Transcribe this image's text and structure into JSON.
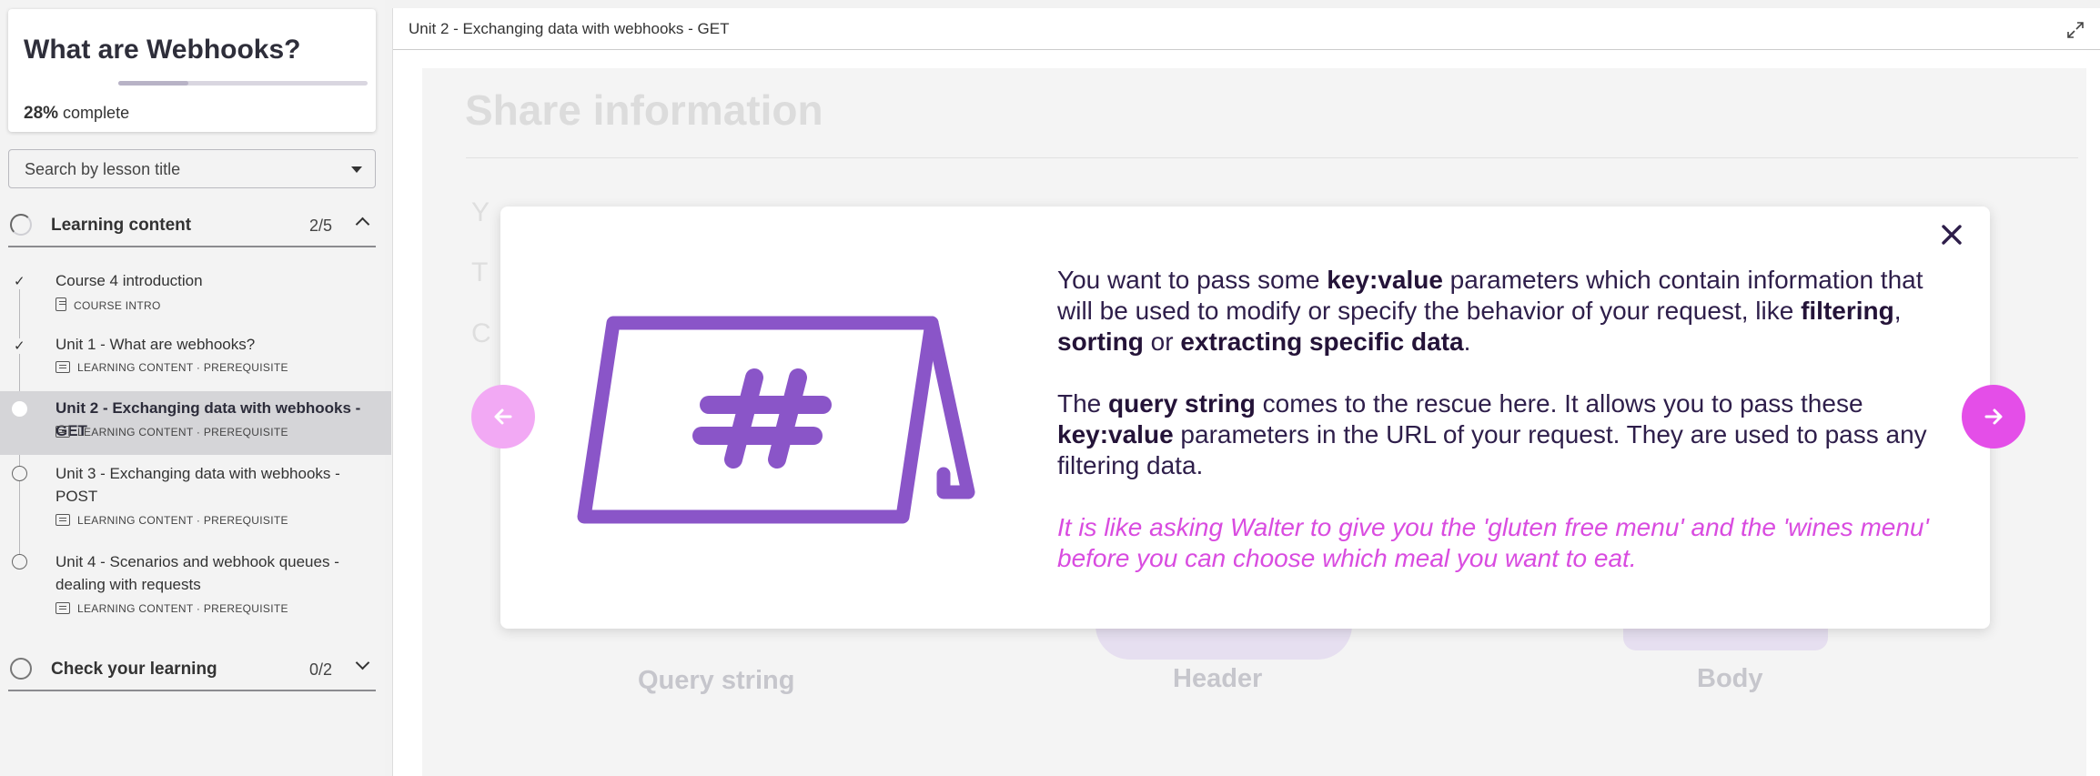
{
  "sidebar": {
    "course_title": "What are Webhooks?",
    "progress_percent": 28,
    "progress_pct_label": "28%",
    "progress_suffix": "complete",
    "search_placeholder": "Search by lesson title",
    "sections": [
      {
        "title": "Learning content",
        "count": "2/5",
        "expanded": true,
        "lessons": [
          {
            "name": "Course 4 introduction",
            "meta": "COURSE INTRO",
            "completed": true,
            "icon": "document-icon"
          },
          {
            "name": "Unit 1 - What are webhooks?",
            "meta": "LEARNING CONTENT · PREREQUISITE",
            "completed": true,
            "icon": "slides-icon"
          },
          {
            "name": "Unit 2 - Exchanging data with webhooks - GET",
            "meta": "LEARNING CONTENT · PREREQUISITE",
            "completed": false,
            "active": true,
            "icon": "slides-icon"
          },
          {
            "name": "Unit 3 - Exchanging data with webhooks - POST",
            "meta": "LEARNING CONTENT · PREREQUISITE",
            "completed": false,
            "icon": "slides-icon"
          },
          {
            "name": "Unit 4 - Scenarios and webhook queues - dealing with requests",
            "meta": "LEARNING CONTENT · PREREQUISITE",
            "completed": false,
            "icon": "slides-icon"
          }
        ]
      },
      {
        "title": "Check your learning",
        "count": "0/2",
        "expanded": false
      }
    ]
  },
  "main": {
    "lesson_title": "Unit 2 - Exchanging data with webhooks - GET",
    "slide": {
      "heading": "Share information",
      "background_labels": [
        "Query string",
        "Header",
        "Body"
      ]
    },
    "modal": {
      "paragraph1": {
        "t1": "You want to pass some ",
        "b1": "key:value",
        "t2": " parameters which contain information that will be used to modify or specify the behavior of your request, like ",
        "b2": "filtering",
        "t3": ", ",
        "b3": "sorting",
        "t4": " or ",
        "b4": "extracting specific data",
        "t5": "."
      },
      "paragraph2": {
        "t1": "The ",
        "b1": "query string",
        "t2": " comes to the rescue here. It allows you to pass these ",
        "b2": "key:value",
        "t3": " parameters in the URL of your request. They are used to pass any filtering data."
      },
      "accent_text": "It is like asking Walter to give you the 'gluten free menu' and the 'wines menu' before you can choose which meal you want to eat."
    }
  },
  "colors": {
    "accent_pink": "#e44ee8",
    "accent_pink_light": "#f2a9f4",
    "illustration_purple": "#8a55c8",
    "text_dark": "#2e1e4a"
  },
  "icons": [
    "expand-icon",
    "close-icon",
    "arrow-left-icon",
    "arrow-right-icon",
    "hashtag-sign-icon",
    "chevron-up-icon",
    "chevron-down-icon",
    "check-icon",
    "dropdown-caret-icon"
  ]
}
